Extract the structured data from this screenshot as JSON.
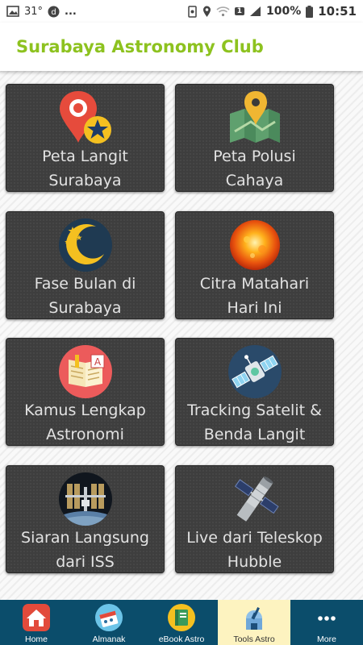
{
  "status_bar": {
    "temperature": "31°",
    "dots": "...",
    "sim_badge": "1",
    "battery": "100%",
    "time": "10:51"
  },
  "app_bar": {
    "title": "Surabaya Astronomy Club",
    "title_color": "#8dc21f"
  },
  "tiles": [
    {
      "line1": "Peta Langit",
      "line2": "Surabaya",
      "icon": "map-pin-star-icon"
    },
    {
      "line1": "Peta Polusi",
      "line2": "Cahaya",
      "icon": "folded-map-icon"
    },
    {
      "line1": "Fase Bulan di",
      "line2": "Surabaya",
      "icon": "crescent-moon-icon"
    },
    {
      "line1": "Citra Matahari",
      "line2": "Hari Ini",
      "icon": "sun-icon"
    },
    {
      "line1": "Kamus Lengkap",
      "line2": "Astronomi",
      "icon": "dictionary-book-icon"
    },
    {
      "line1": "Tracking Satelit &",
      "line2": "Benda Langit",
      "icon": "satellite-icon"
    },
    {
      "line1": "Siaran Langsung",
      "line2": "dari ISS",
      "icon": "space-station-icon"
    },
    {
      "line1": "Live dari Teleskop",
      "line2": "Hubble",
      "icon": "hubble-telescope-icon"
    }
  ],
  "bottom_nav": {
    "items": [
      {
        "label": "Home",
        "icon": "home-icon"
      },
      {
        "label": "Almanak",
        "icon": "almanac-icon"
      },
      {
        "label": "eBook Astro",
        "icon": "ebook-icon"
      },
      {
        "label": "Tools Astro",
        "icon": "observatory-icon",
        "active": true
      },
      {
        "label": "More",
        "icon": "more-dots-icon"
      }
    ],
    "bg_color": "#0b4d6b",
    "active_color": "#fdf3c0"
  }
}
